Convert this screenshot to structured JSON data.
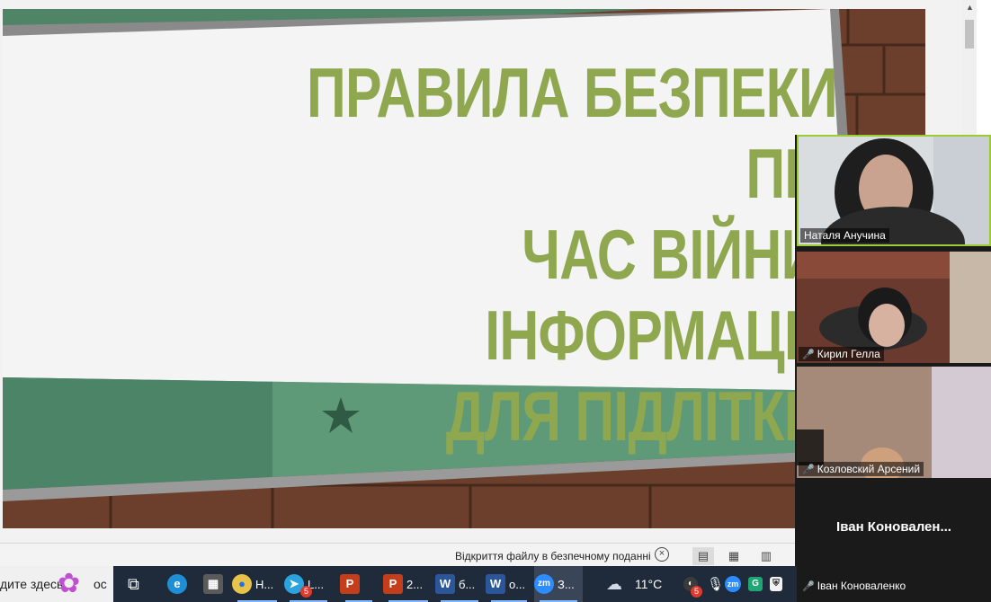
{
  "slide": {
    "title_lines": "ПРАВИЛА БЕЗПЕКИ ПІД\nЧАС ВІЙНИ: ІНФОРМАЦІЯ\nДЛЯ ПІДЛІТКІВ",
    "colors": {
      "title": "#8fa850",
      "band": "#5e9a78",
      "brick": "#6b3f2c"
    }
  },
  "status_bar": {
    "text": "Відкриття файлу в безпечному поданні",
    "close_icon": "close-circle-icon",
    "views": [
      "read-mode-icon",
      "print-layout-icon",
      "web-layout-icon"
    ]
  },
  "participants": [
    {
      "name": "Наталя Анучина",
      "muted": false,
      "active": true
    },
    {
      "name": "Кирил Гелла",
      "muted": true,
      "active": false
    },
    {
      "name": "Козловский Арсений",
      "muted": true,
      "active": false
    },
    {
      "name": "Іван Коноваленко",
      "display_name": "Іван  Коновален...",
      "muted": true,
      "active": false,
      "video_off": true
    }
  ],
  "taskbar": {
    "search_text": "дите здесь",
    "search_suffix": "ос",
    "apps": [
      {
        "label": "Н...",
        "icon": "chrome-icon"
      },
      {
        "label": "L...",
        "icon": "telegram-icon",
        "badge": "5"
      },
      {
        "label": "",
        "icon": "powerpoint-icon"
      },
      {
        "label": "2...",
        "icon": "powerpoint-icon"
      },
      {
        "label": "б...",
        "icon": "word-icon"
      },
      {
        "label": "о...",
        "icon": "word-icon"
      },
      {
        "label": "З...",
        "icon": "zoom-icon"
      }
    ],
    "weather": "11°C",
    "tray_badge": "5"
  }
}
